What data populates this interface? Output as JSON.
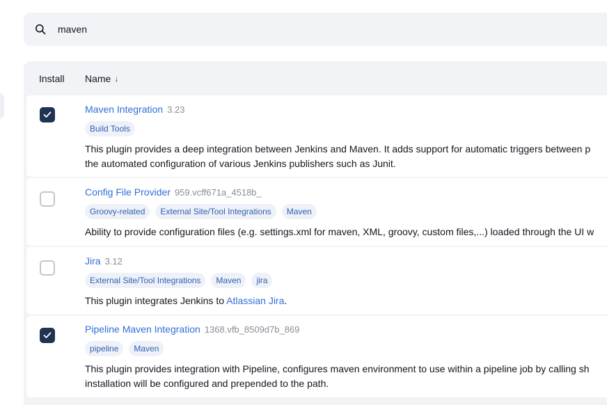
{
  "search": {
    "value": "maven",
    "icon": "search-icon"
  },
  "table": {
    "headers": {
      "install": "Install",
      "name": "Name",
      "sort_indicator": "↓"
    },
    "rows": [
      {
        "checked": true,
        "name": "Maven Integration",
        "version": "3.23",
        "tags": [
          "Build Tools"
        ],
        "desc_lines": [
          "This plugin provides a deep integration between Jenkins and Maven. It adds support for automatic triggers between p",
          "the automated configuration of various Jenkins publishers such as Junit."
        ]
      },
      {
        "checked": false,
        "name": "Config File Provider",
        "version": "959.vcff671a_4518b_",
        "tags": [
          "Groovy-related",
          "External Site/Tool Integrations",
          "Maven"
        ],
        "desc_lines": [
          "Ability to provide configuration files (e.g. settings.xml for maven, XML, groovy, custom files,...) loaded through the UI w"
        ]
      },
      {
        "checked": false,
        "name": "Jira",
        "version": "3.12",
        "tags": [
          "External Site/Tool Integrations",
          "Maven",
          "jira"
        ],
        "desc_prefix": "This plugin integrates Jenkins to ",
        "desc_link": "Atlassian Jira",
        "desc_suffix": "."
      },
      {
        "checked": true,
        "name": "Pipeline Maven Integration",
        "version": "1368.vfb_8509d7b_869",
        "tags": [
          "pipeline",
          "Maven"
        ],
        "desc_lines": [
          "This plugin provides integration with Pipeline, configures maven environment to use within a pipeline job by calling sh",
          "installation will be configured and prepended to the path."
        ]
      }
    ]
  }
}
